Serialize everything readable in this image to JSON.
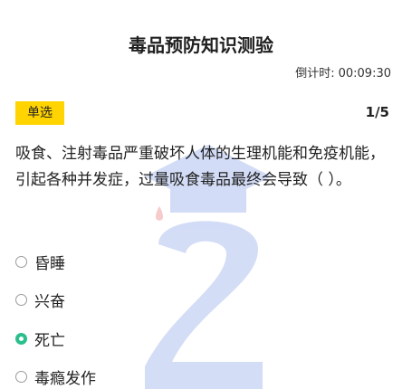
{
  "header": {
    "title": "毒品预防知识测验"
  },
  "timer": {
    "label": "倒计时:",
    "value": "00:09:30"
  },
  "question": {
    "type_badge": "单选",
    "progress": "1/5",
    "text": "吸食、注射毒品严重破坏人体的生理机能和免疫机能，引起各种并发症，过量吸食毒品最终会导致（ ）。"
  },
  "options": [
    {
      "label": "昏睡",
      "selected": false
    },
    {
      "label": "兴奋",
      "selected": false
    },
    {
      "label": "死亡",
      "selected": true
    },
    {
      "label": "毒瘾发作",
      "selected": false
    }
  ],
  "colors": {
    "badge": "#ffd400",
    "selected_radio": "#2bbf8c",
    "watermark": "#3b63d8"
  },
  "watermark_icon": "graduation-2-watermark-icon"
}
